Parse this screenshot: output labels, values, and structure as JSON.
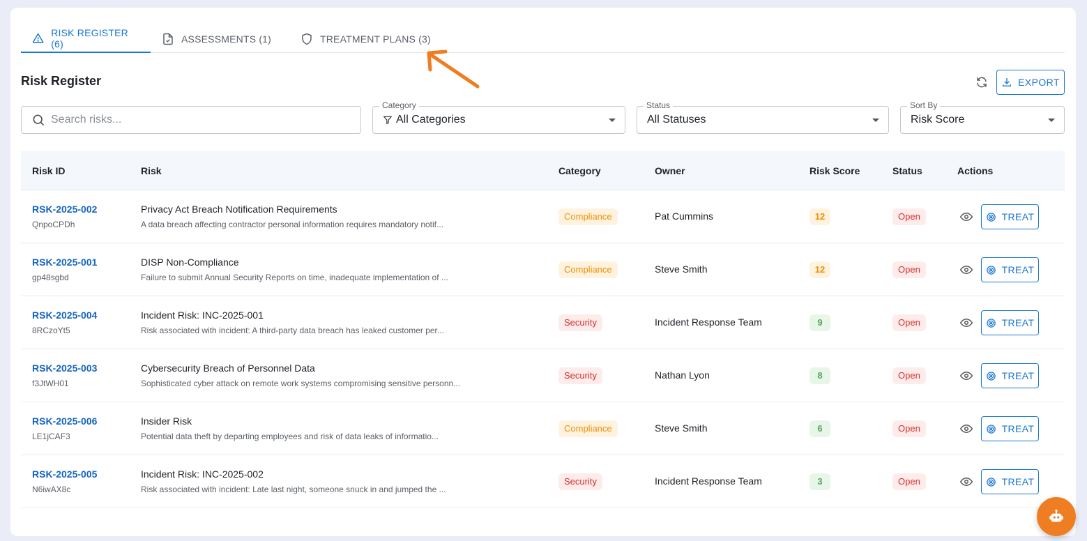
{
  "tabs": [
    {
      "label": "RISK REGISTER (6)",
      "icon": "warning-icon",
      "active": true
    },
    {
      "label": "ASSESSMENTS (1)",
      "icon": "clipboard-check-icon",
      "active": false
    },
    {
      "label": "TREATMENT PLANS (3)",
      "icon": "shield-icon",
      "active": false
    }
  ],
  "section": {
    "title": "Risk Register",
    "export_label": "EXPORT"
  },
  "filters": {
    "search_placeholder": "Search risks...",
    "category_label": "Category",
    "category_value": "All Categories",
    "status_label": "Status",
    "status_value": "All Statuses",
    "sort_label": "Sort By",
    "sort_value": "Risk Score"
  },
  "table": {
    "headers": [
      "Risk ID",
      "Risk",
      "Category",
      "Owner",
      "Risk Score",
      "Status",
      "Actions"
    ],
    "treat_label": "TREAT",
    "rows": [
      {
        "id": "RSK-2025-002",
        "sub": "QnpoCPDh",
        "title": "Privacy Act Breach Notification Requirements",
        "desc": "A data breach affecting contractor personal information requires mandatory notif...",
        "category": "Compliance",
        "owner": "Pat Cummins",
        "score": "12",
        "status": "Open"
      },
      {
        "id": "RSK-2025-001",
        "sub": "gp48sgbd",
        "title": "DISP Non-Compliance",
        "desc": "Failure to submit Annual Security Reports on time, inadequate implementation of ...",
        "category": "Compliance",
        "owner": "Steve Smith",
        "score": "12",
        "status": "Open"
      },
      {
        "id": "RSK-2025-004",
        "sub": "8RCzoYt5",
        "title": "Incident Risk: INC-2025-001",
        "desc": "Risk associated with incident: A third-party data breach has leaked customer per...",
        "category": "Security",
        "owner": "Incident Response Team",
        "score": "9",
        "status": "Open"
      },
      {
        "id": "RSK-2025-003",
        "sub": "f3JtWH01",
        "title": "Cybersecurity Breach of Personnel Data",
        "desc": "Sophisticated cyber attack on remote work systems compromising sensitive personn...",
        "category": "Security",
        "owner": "Nathan Lyon",
        "score": "8",
        "status": "Open"
      },
      {
        "id": "RSK-2025-006",
        "sub": "LE1jCAF3",
        "title": "Insider Risk",
        "desc": "Potential data theft by departing employees and risk of data leaks of informatio...",
        "category": "Compliance",
        "owner": "Steve Smith",
        "score": "6",
        "status": "Open"
      },
      {
        "id": "RSK-2025-005",
        "sub": "N6iwAX8c",
        "title": "Incident Risk: INC-2025-002",
        "desc": "Risk associated with incident: Late last night, someone snuck in and jumped the ...",
        "category": "Security",
        "owner": "Incident Response Team",
        "score": "3",
        "status": "Open"
      }
    ]
  },
  "colors": {
    "accent": "#1976d2",
    "fab": "#ef7d22",
    "arrow": "#f07c1e"
  }
}
